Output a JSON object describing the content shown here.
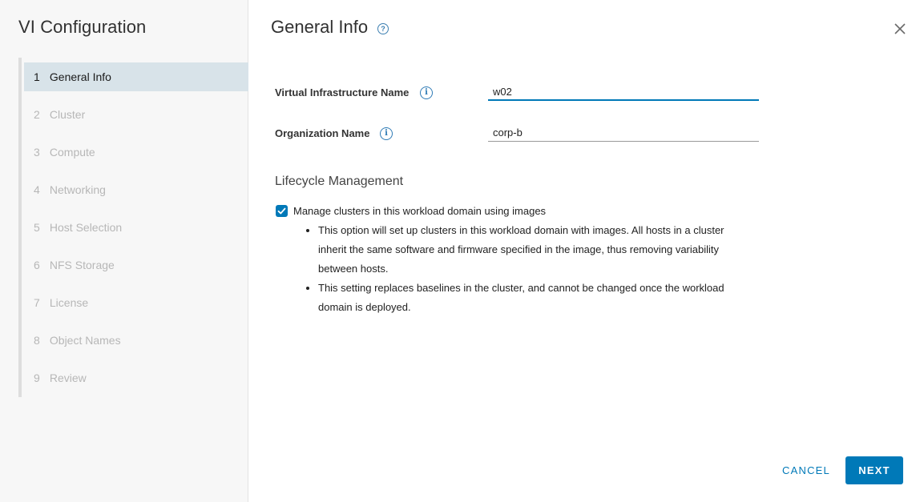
{
  "sidebar": {
    "title": "VI Configuration",
    "steps": [
      {
        "num": "1",
        "label": "General Info",
        "active": true
      },
      {
        "num": "2",
        "label": "Cluster"
      },
      {
        "num": "3",
        "label": "Compute"
      },
      {
        "num": "4",
        "label": "Networking"
      },
      {
        "num": "5",
        "label": "Host Selection"
      },
      {
        "num": "6",
        "label": "NFS Storage"
      },
      {
        "num": "7",
        "label": "License"
      },
      {
        "num": "8",
        "label": "Object Names"
      },
      {
        "num": "9",
        "label": "Review"
      }
    ]
  },
  "main": {
    "title": "General Info",
    "help_icon": "question-circle-icon",
    "close_icon": "close-icon",
    "fields": {
      "vi_name": {
        "label": "Virtual Infrastructure Name",
        "value": "w02",
        "icon": "info-icon"
      },
      "org_name": {
        "label": "Organization Name",
        "value": "corp-b",
        "icon": "info-icon"
      }
    },
    "lifecycle": {
      "title": "Lifecycle Management",
      "checkbox_label": "Manage clusters in this workload domain using images",
      "checked": true,
      "bullets": [
        "This option will set up clusters in this workload domain with images. All hosts in a cluster inherit the same software and firmware specified in the image, thus removing variability between hosts.",
        "This setting replaces baselines in the cluster, and cannot be changed once the workload domain is deployed."
      ]
    }
  },
  "footer": {
    "cancel_label": "CANCEL",
    "next_label": "NEXT"
  },
  "colors": {
    "accent": "#0079b8",
    "active_step_bg": "#d8e3e9",
    "sidebar_bg": "#f7f7f7"
  }
}
